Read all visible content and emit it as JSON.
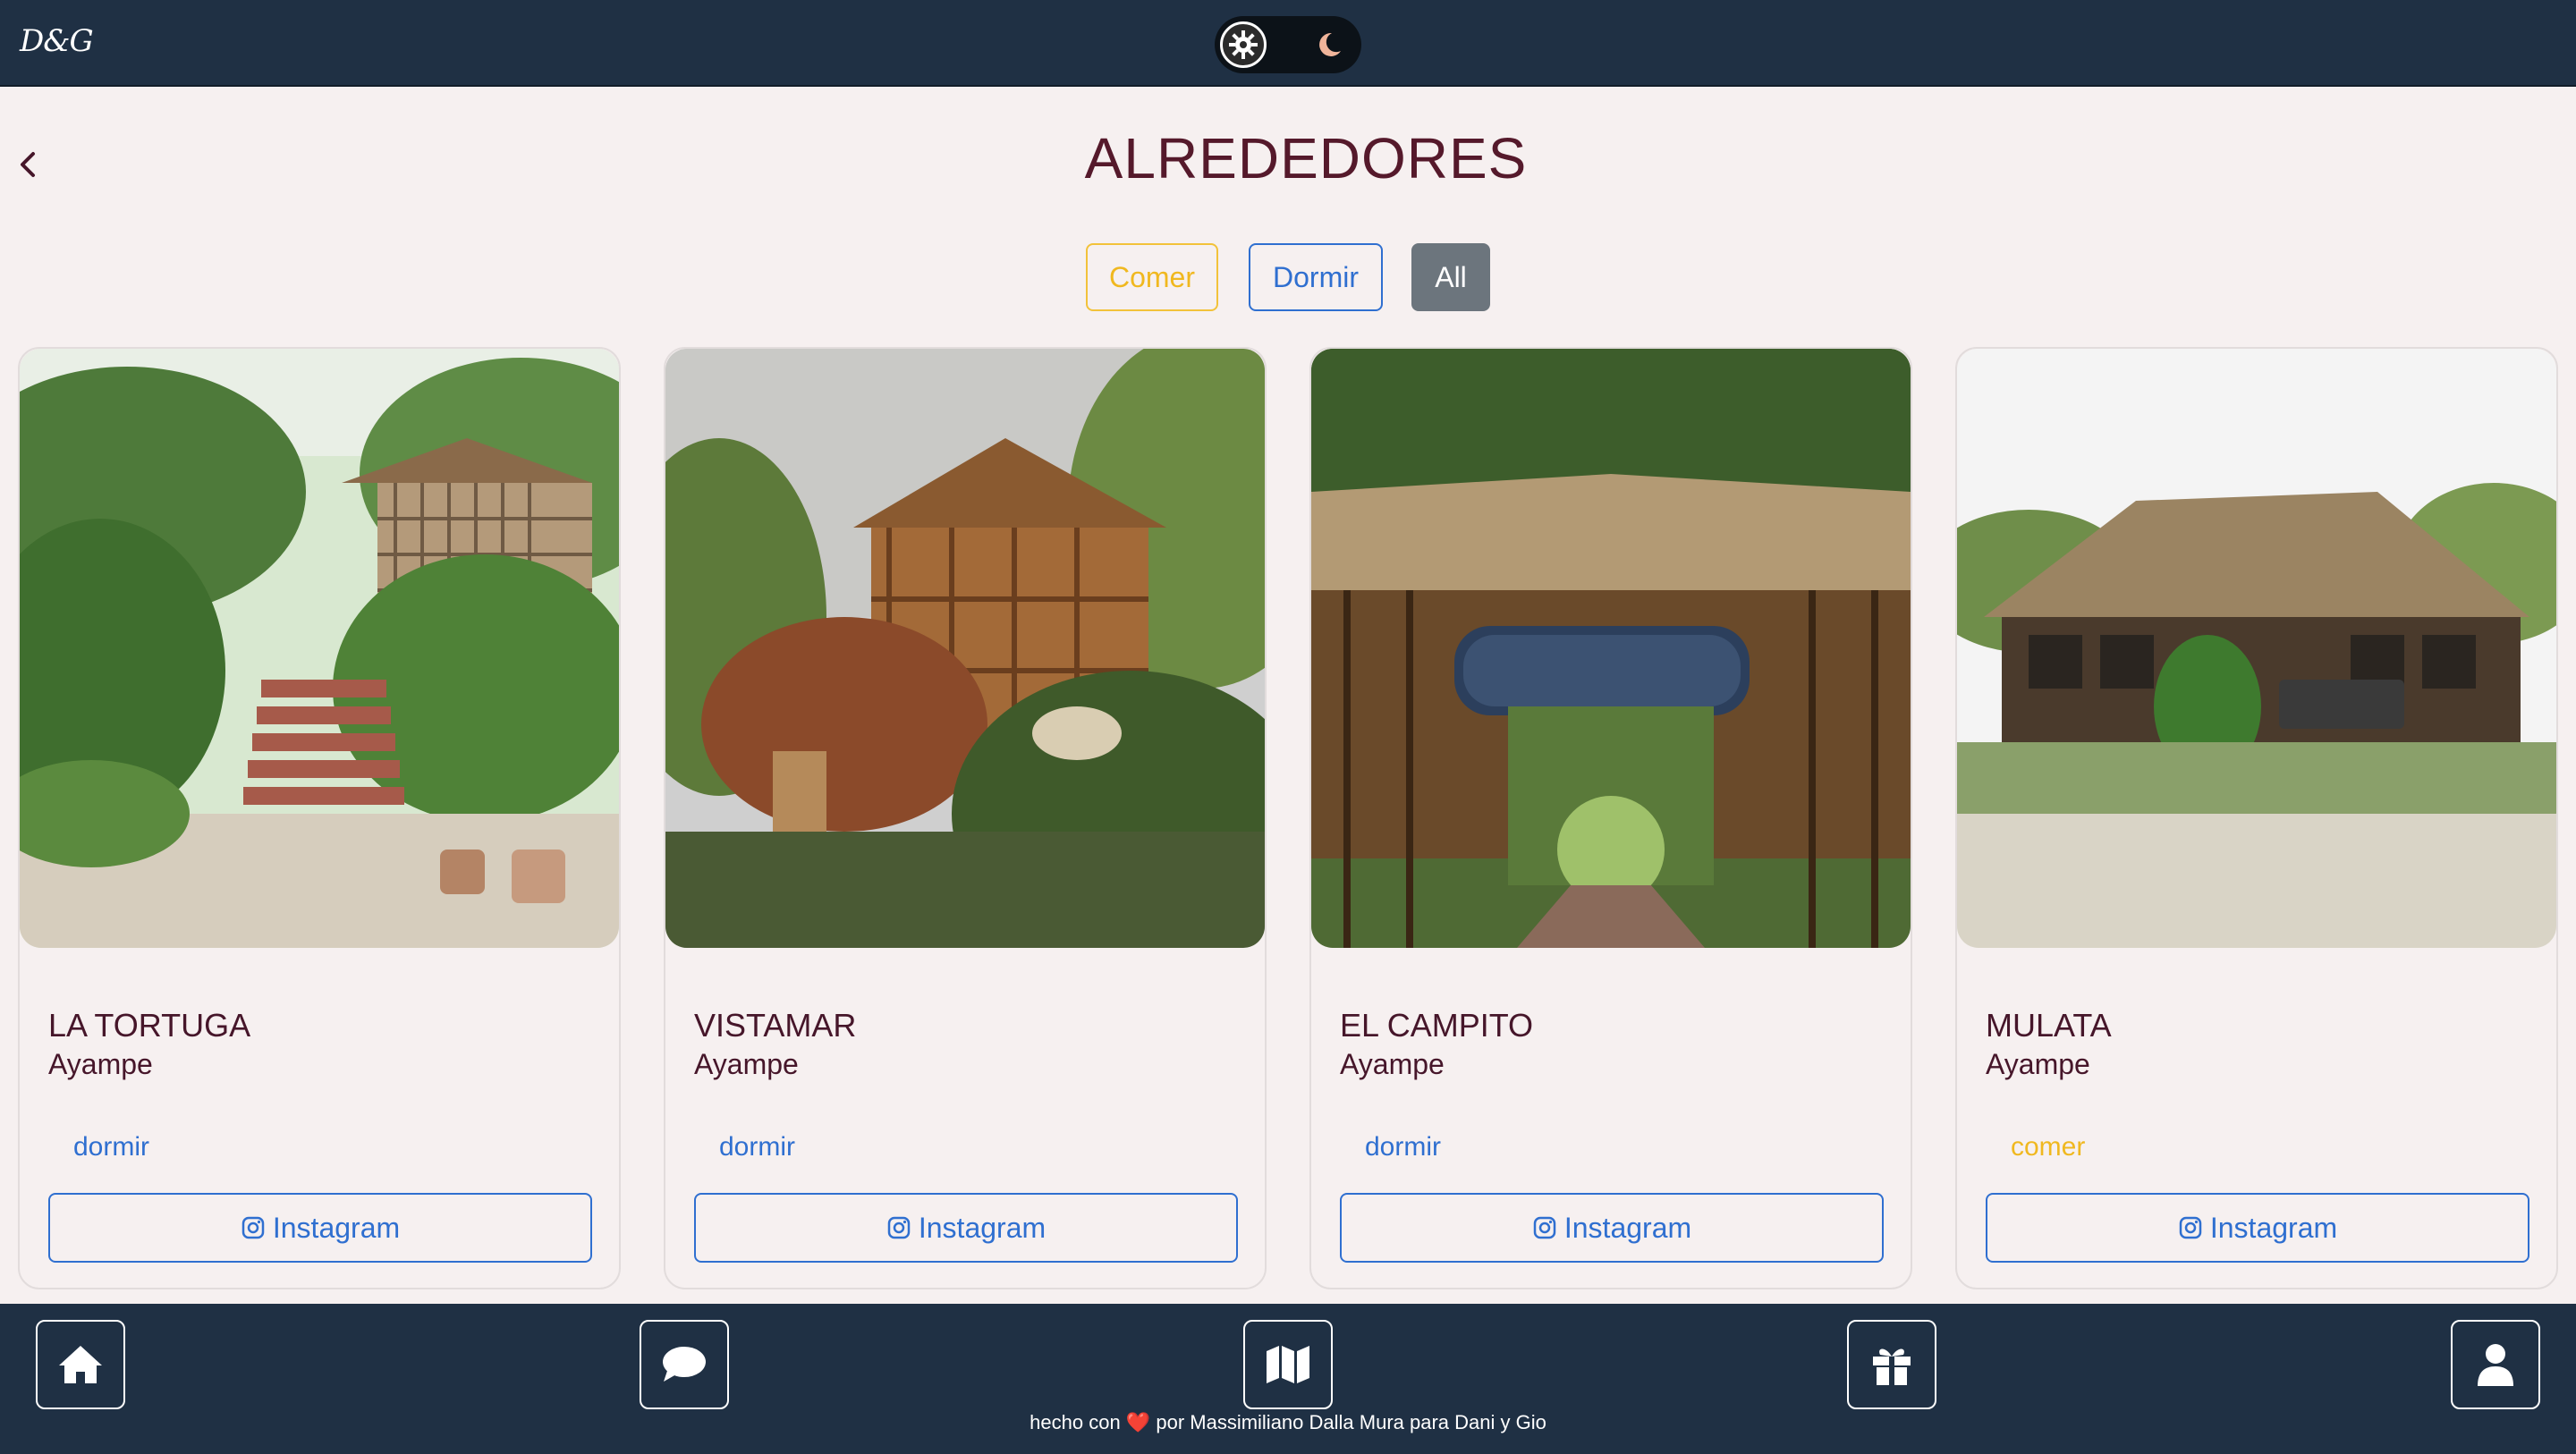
{
  "topbar": {
    "logo": "D&G",
    "theme_toggle": {
      "light_icon": "sun-gear-icon",
      "dark_icon": "moon-icon",
      "moon_color": "#f0b49a"
    }
  },
  "header": {
    "title": "ALREDEDORES",
    "back_icon": "chevron-left-icon"
  },
  "filters": [
    {
      "label": "Comer",
      "color": "#f0b81f",
      "active": false
    },
    {
      "label": "Dormir",
      "color": "#2f6fd0",
      "active": false
    },
    {
      "label": "All",
      "color": "#6c757d",
      "active": true
    }
  ],
  "cards": [
    {
      "name": "LA TORTUGA",
      "location": "Ayampe",
      "category": "dormir",
      "button": "Instagram"
    },
    {
      "name": "VISTAMAR",
      "location": "Ayampe",
      "category": "dormir",
      "button": "Instagram"
    },
    {
      "name": "EL CAMPITO",
      "location": "Ayampe",
      "category": "dormir",
      "button": "Instagram"
    },
    {
      "name": "MULATA",
      "location": "Ayampe",
      "category": "comer",
      "button": "Instagram"
    }
  ],
  "bottom_nav": [
    {
      "icon": "home-icon"
    },
    {
      "icon": "chat-bubble-icon"
    },
    {
      "icon": "map-icon"
    },
    {
      "icon": "gift-icon"
    },
    {
      "icon": "user-icon"
    }
  ],
  "footer": {
    "prefix": "hecho con",
    "heart": "❤️",
    "suffix": "por Massimiliano Dalla Mura para Dani y Gio"
  },
  "colors": {
    "navbar": "#1f3044",
    "background": "#f6f0f0",
    "title": "#55192b",
    "primary": "#2f6fd0",
    "warning": "#f0b81f",
    "secondary": "#6c757d"
  }
}
